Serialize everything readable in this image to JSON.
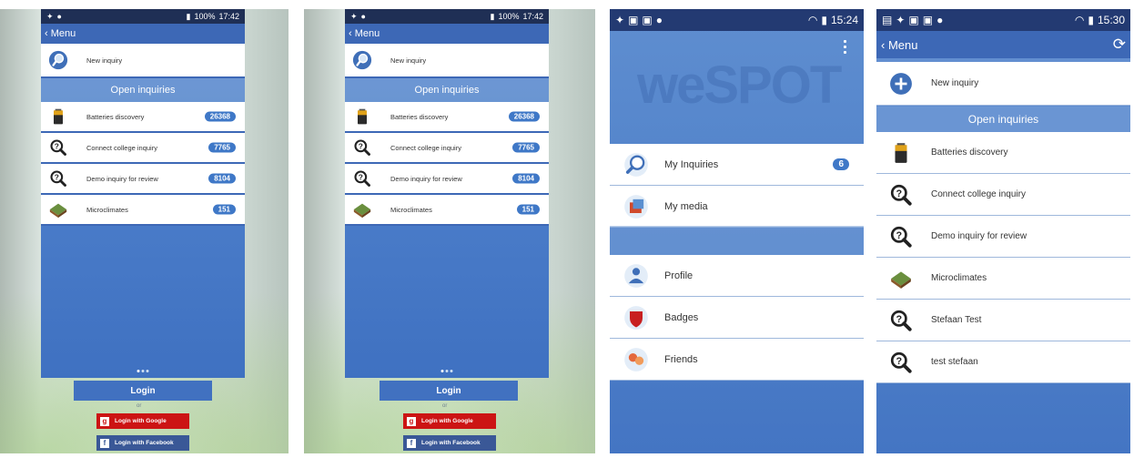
{
  "panel1": {
    "status_time": "17:42",
    "status_battery": "100%",
    "back_label": "‹ Menu",
    "new_inquiry": "New inquiry",
    "open_inquiries": "Open inquiries",
    "inquiries": [
      {
        "label": "Batteries discovery",
        "count": "26368"
      },
      {
        "label": "Connect college inquiry",
        "count": "7765"
      },
      {
        "label": "Demo inquiry for review",
        "count": "8104"
      },
      {
        "label": "Microclimates",
        "count": "151"
      }
    ],
    "login": "Login",
    "or": "or",
    "login_google": "Login with Google",
    "login_facebook": "Login with Facebook"
  },
  "panel2": {
    "status_time": "17:42",
    "status_battery": "100%",
    "back_label": "‹ Menu",
    "new_inquiry": "New inquiry",
    "open_inquiries": "Open inquiries",
    "inquiries": [
      {
        "label": "Batteries discovery",
        "count": "26368"
      },
      {
        "label": "Connect college inquiry",
        "count": "7765"
      },
      {
        "label": "Demo inquiry for review",
        "count": "8104"
      },
      {
        "label": "Microclimates",
        "count": "151"
      }
    ],
    "login": "Login",
    "or": "or",
    "login_google": "Login with Google",
    "login_facebook": "Login with Facebook"
  },
  "panel3": {
    "status_time": "15:24",
    "logo": "weSPOT",
    "items_top": [
      {
        "label": "My Inquiries",
        "count": "6",
        "icon": "magnifier-icon"
      },
      {
        "label": "My media",
        "icon": "media-icon"
      }
    ],
    "items_bottom": [
      {
        "label": "Profile",
        "icon": "profile-icon"
      },
      {
        "label": "Badges",
        "icon": "badge-icon"
      },
      {
        "label": "Friends",
        "icon": "friends-icon"
      }
    ]
  },
  "panel4": {
    "status_time": "15:30",
    "back_label": "‹ Menu",
    "new_inquiry": "New inquiry",
    "open_inquiries": "Open inquiries",
    "inquiries": [
      {
        "label": "Batteries discovery",
        "icon": "battery-icon"
      },
      {
        "label": "Connect college inquiry",
        "icon": "question-magnifier-icon"
      },
      {
        "label": "Demo inquiry for review",
        "icon": "question-magnifier-icon"
      },
      {
        "label": "Microclimates",
        "icon": "house-icon"
      },
      {
        "label": "Stefaan Test",
        "icon": "question-magnifier-icon"
      },
      {
        "label": "test stefaan",
        "icon": "question-magnifier-icon"
      }
    ]
  },
  "colors": {
    "primary": "#3d68b6",
    "badge": "#3f78c7",
    "google": "#cc1414",
    "facebook": "#3a5897"
  }
}
